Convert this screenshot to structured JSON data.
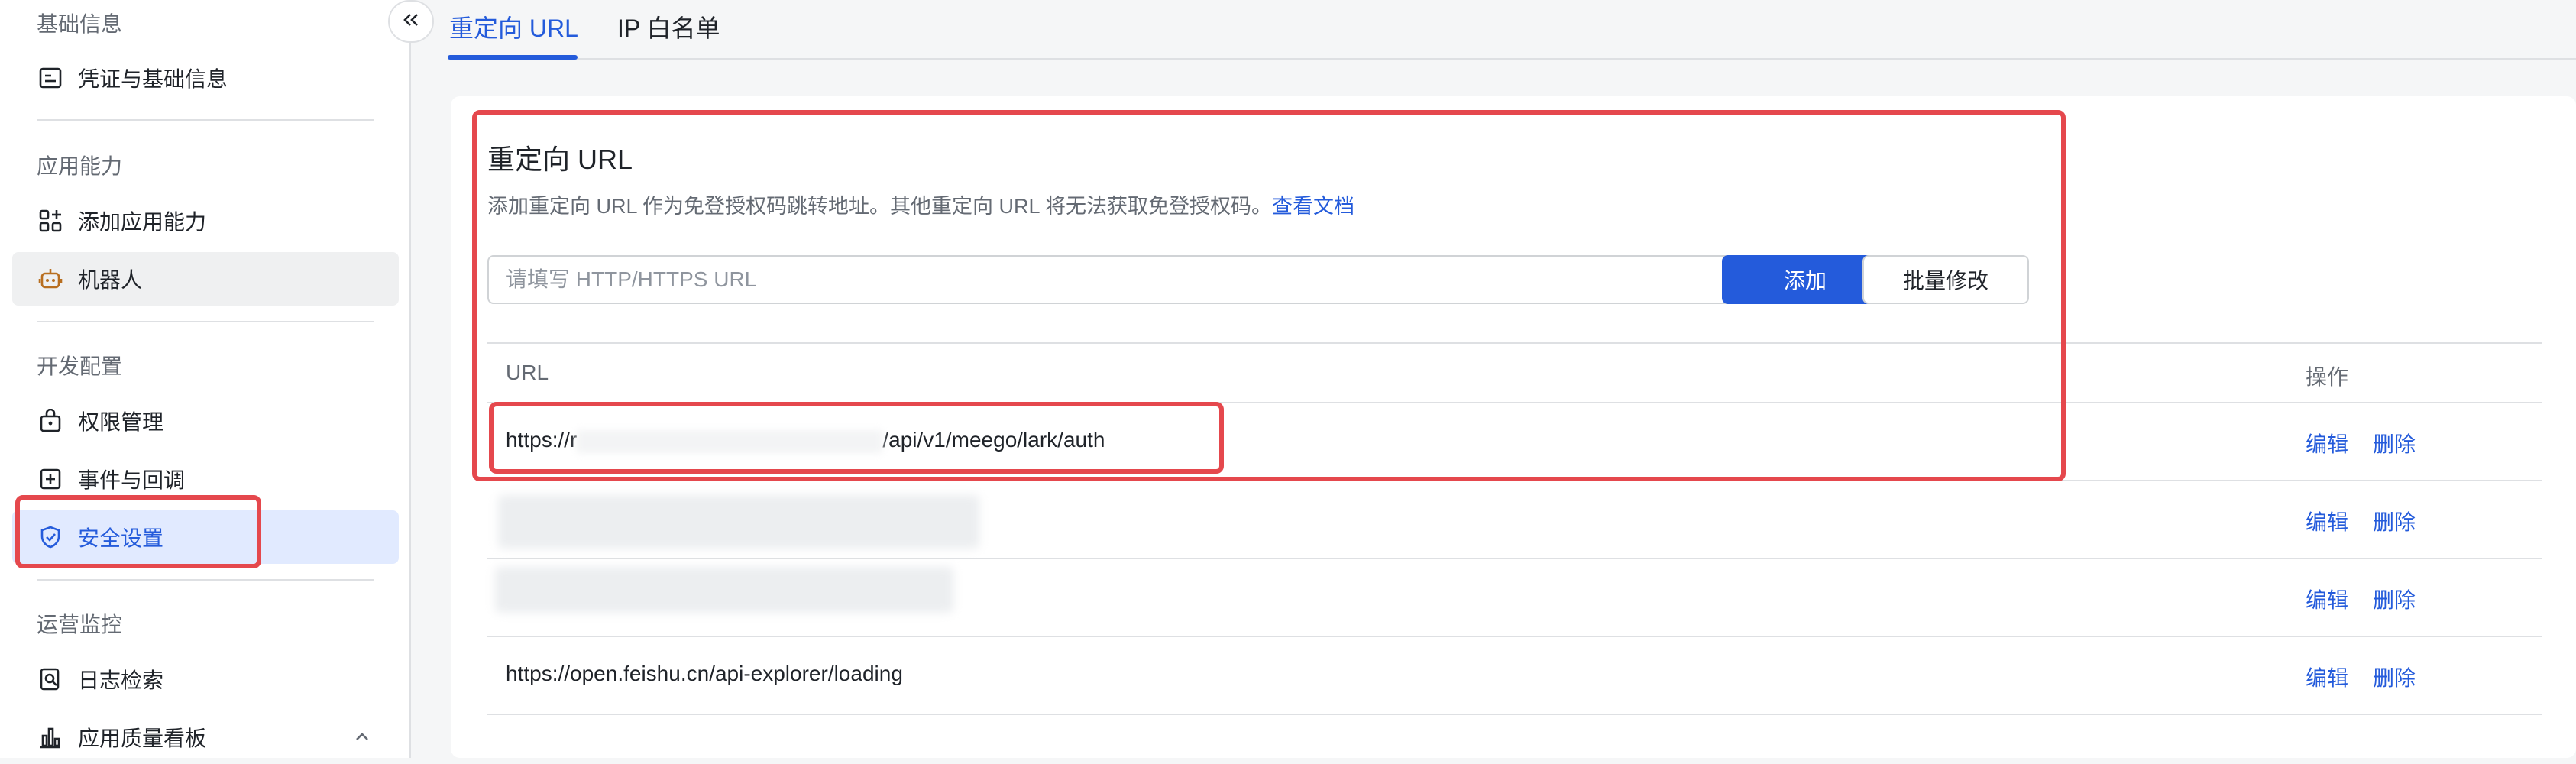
{
  "sidebar": {
    "groups": [
      {
        "title": "基础信息"
      },
      {
        "title": "应用能力"
      },
      {
        "title": "开发配置"
      },
      {
        "title": "运营监控"
      }
    ],
    "items": [
      {
        "label": "凭证与基础信息",
        "icon": "credential-icon"
      },
      {
        "label": "添加应用能力",
        "icon": "add-capability-icon"
      },
      {
        "label": "机器人",
        "icon": "robot-icon"
      },
      {
        "label": "权限管理",
        "icon": "permission-icon"
      },
      {
        "label": "事件与回调",
        "icon": "event-icon"
      },
      {
        "label": "安全设置",
        "icon": "shield-icon"
      },
      {
        "label": "日志检索",
        "icon": "log-search-icon"
      },
      {
        "label": "应用质量看板",
        "icon": "chart-icon"
      }
    ]
  },
  "tabs": [
    {
      "label": "重定向 URL"
    },
    {
      "label": "IP 白名单"
    }
  ],
  "card": {
    "title": "重定向 URL",
    "desc": "添加重定向 URL 作为免登授权码跳转地址。其他重定向 URL 将无法获取免登授权码。",
    "doc_link": "查看文档",
    "input_placeholder": "请填写 HTTP/HTTPS URL",
    "add_label": "添加",
    "bulk_label": "批量修改"
  },
  "table": {
    "headers": {
      "url": "URL",
      "action": "操作"
    },
    "rows": [
      {
        "url_prefix": "https://r",
        "url_suffix": "/api/v1/meego/lark/auth",
        "edit": "编辑",
        "delete": "删除"
      },
      {
        "url": "",
        "edit": "编辑",
        "delete": "删除"
      },
      {
        "url": "",
        "edit": "编辑",
        "delete": "删除"
      },
      {
        "url": "https://open.feishu.cn/api-explorer/loading",
        "edit": "编辑",
        "delete": "删除"
      }
    ]
  },
  "colors": {
    "accent": "#245bdb",
    "highlight": "#e5484d"
  }
}
